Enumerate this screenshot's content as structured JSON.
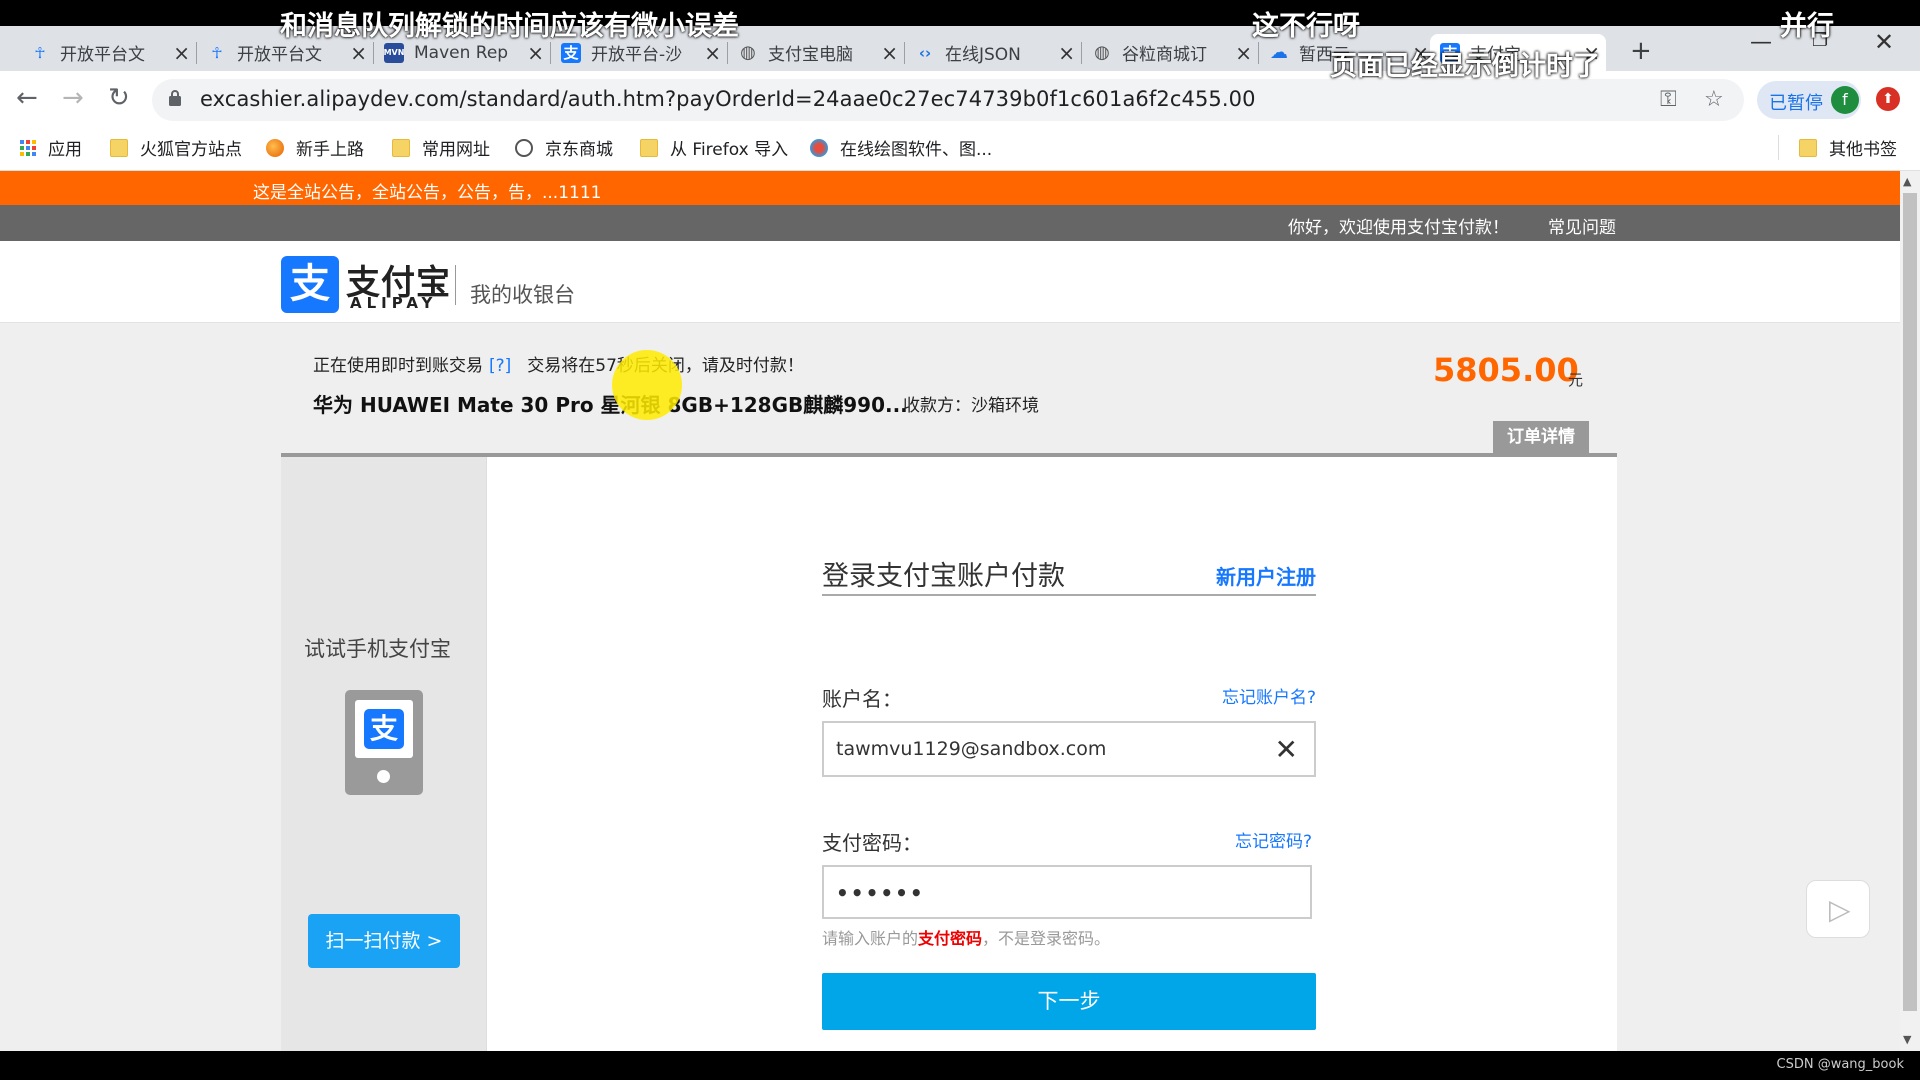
{
  "browser": {
    "tabs": [
      {
        "label": "开放平台文",
        "icon": "robot-icon",
        "color": "#1677ff"
      },
      {
        "label": "开放平台文",
        "icon": "robot-icon",
        "color": "#1677ff"
      },
      {
        "label": "Maven Rep",
        "icon": "mvn-icon",
        "color": "#2a4d9b"
      },
      {
        "label": "开放平台-沙",
        "icon": "alipay-icon",
        "color": "#1677ff"
      },
      {
        "label": "支付宝电脑",
        "icon": "globe-icon",
        "color": "#555555"
      },
      {
        "label": "在线JSON",
        "icon": "code-icon",
        "color": "#1a73e8"
      },
      {
        "label": "谷粒商城订",
        "icon": "globe-icon",
        "color": "#555555"
      },
      {
        "label": "暂西云",
        "icon": "cloud-icon",
        "color": "#1a73e8"
      },
      {
        "label": "支付宝",
        "icon": "alipay-icon",
        "color": "#1677ff",
        "active": true
      }
    ],
    "url": "excashier.alipaydev.com/standard/auth.htm?payOrderId=24aae0c27ec74739b0f1c601a6f2c455.00",
    "paused_label": "已暂停",
    "avatar_letter": "f",
    "bookmarks": [
      {
        "label": "应用",
        "icon": "apps-icon"
      },
      {
        "label": "火狐官方站点",
        "icon": "folder-icon"
      },
      {
        "label": "新手上路",
        "icon": "firefox-icon"
      },
      {
        "label": "常用网址",
        "icon": "folder-icon"
      },
      {
        "label": "京东商城",
        "icon": "globe-icon"
      },
      {
        "label": "从 Firefox 导入",
        "icon": "folder-icon"
      },
      {
        "label": "在线绘图软件、图...",
        "icon": "draw-icon"
      }
    ],
    "other_bookmarks": "其他书签"
  },
  "page": {
    "announcement": "这是全站公告，全站公告，公告，告，...1111",
    "topnav": {
      "welcome": "你好，欢迎使用支付宝付款！",
      "faq": "常见问题"
    },
    "logo": {
      "glyph": "支",
      "cn": "支付宝",
      "en": "ALIPAY",
      "subtitle": "我的收银台"
    },
    "order": {
      "notice_prefix": "正在使用即时到账交易",
      "notice_help": "[?]",
      "notice_countdown": "交易将在57秒后关闭，请及时付款！",
      "product": "华为 HUAWEI Mate 30 Pro 星河银 8GB+128GB麒麟990...",
      "payee": "收款方：沙箱环境",
      "amount": "5805.00",
      "currency": "元",
      "detail_tab": "订单详情"
    },
    "sidebar": {
      "try_mobile": "试试手机支付宝",
      "scan_button": "扫一扫付款 >"
    },
    "login": {
      "title": "登录支付宝账户付款",
      "register": "新用户注册",
      "account_label": "账户名：",
      "forgot_account": "忘记账户名?",
      "account_value": "tawmvu1129@sandbox.com",
      "password_label": "支付密码：",
      "forgot_password": "忘记密码?",
      "password_value": "••••••",
      "hint_prefix": "请输入账户的",
      "hint_highlight": "支付密码",
      "hint_suffix": "，不是登录密码。",
      "next_button": "下一步"
    }
  },
  "overlays": {
    "caption_1": "和消息队列解锁的时间应该有微小误差",
    "caption_2": "这不行呀",
    "caption_3": "并行",
    "caption_4": "页面已经显示倒计时了",
    "watermark": "CSDN @wang_book"
  }
}
